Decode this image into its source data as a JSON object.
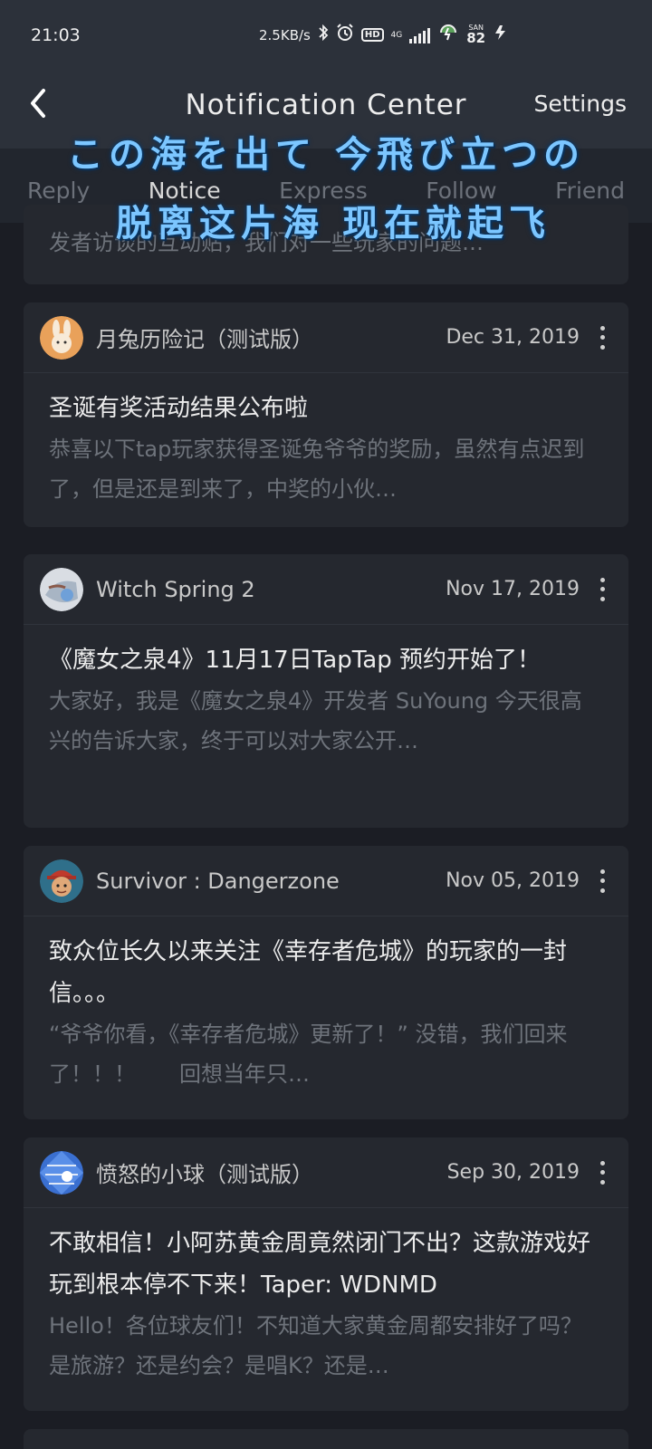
{
  "status_bar": {
    "time": "21:03",
    "net_speed": "2.5KB/s",
    "network": "4G",
    "hd": "HD",
    "battery_label": "SAN",
    "battery": "82"
  },
  "header": {
    "title": "Notification Center",
    "settings_label": "Settings"
  },
  "tabs": [
    {
      "label": "Reply"
    },
    {
      "label": "Notice"
    },
    {
      "label": "Express"
    },
    {
      "label": "Follow"
    },
    {
      "label": "Friend"
    }
  ],
  "lyrics": {
    "line1": "この海を出て 今飛び立つの",
    "line2": "脱离这片海 现在就起飞"
  },
  "partial_card": {
    "summary": "发者访谈的互动贴，我们对一些玩家的问题…"
  },
  "cards": [
    {
      "author": "月兔历险记（测试版）",
      "date": "Dec 31, 2019",
      "title": "圣诞有奖活动结果公布啦",
      "summary": "恭喜以下tap玩家获得圣诞兔爷爷的奖励，虽然有点迟到了，但是还是到来了，中奖的小伙…"
    },
    {
      "author": "Witch Spring 2",
      "date": "Nov 17, 2019",
      "title": "《魔女之泉4》11月17日TapTap 预约开始了！",
      "summary": "大家好，我是《魔女之泉4》开发者 SuYoung 今天很高兴的告诉大家，终于可以对大家公开…"
    },
    {
      "author": "Survivor : Dangerzone",
      "date": "Nov 05, 2019",
      "title": "致众位长久以来关注《幸存者危城》的玩家的一封信。。。",
      "summary": "“爷爷你看，《幸存者危城》更新了！” 没错，我们回来了！！！　　回想当年只…"
    },
    {
      "author": "愤怒的小球（测试版）",
      "date": "Sep 30, 2019",
      "title": "不敢相信！小阿苏黄金周竟然闭门不出？这款游戏好玩到根本停不下来！Taper: WDNMD",
      "summary": "Hello！各位球友们！不知道大家黄金周都安排好了吗？ 是旅游？还是约会？是唱K？还是…"
    }
  ],
  "colors": {
    "background": "#1b1d24",
    "card": "#25282f",
    "header": "#2c313a",
    "lyric": "#7cc6ff"
  }
}
